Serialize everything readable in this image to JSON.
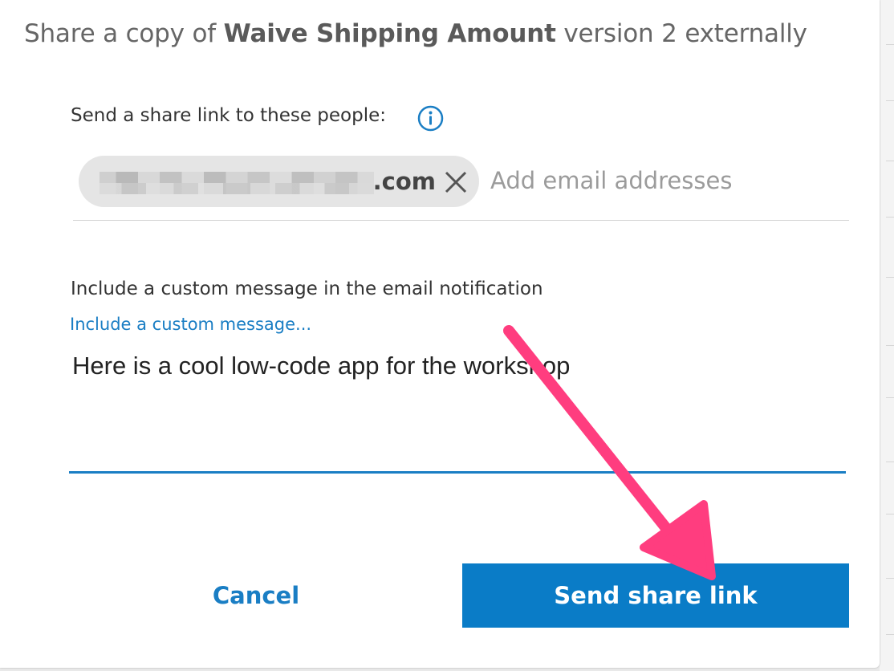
{
  "dialog": {
    "title_prefix": "Share a copy of ",
    "title_app": "Waive Shipping Amount",
    "title_suffix": " version 2 externally"
  },
  "recipients": {
    "label": "Send a share link to these people:",
    "info_icon": "info-circle-icon",
    "chips": [
      {
        "visible_text": ".com",
        "remove_icon": "close-x-icon"
      }
    ],
    "placeholder": "Add email addresses"
  },
  "custom_message": {
    "label": "Include a custom message in the email notification",
    "link": "Include a custom message...",
    "value": "Here is a cool low-code app for the workshop"
  },
  "actions": {
    "cancel_label": "Cancel",
    "send_label": "Send share link"
  },
  "annotation": {
    "arrow_color": "#ff3d7f"
  },
  "colors": {
    "accent": "#0a7cc7",
    "link": "#1a7ec4"
  }
}
